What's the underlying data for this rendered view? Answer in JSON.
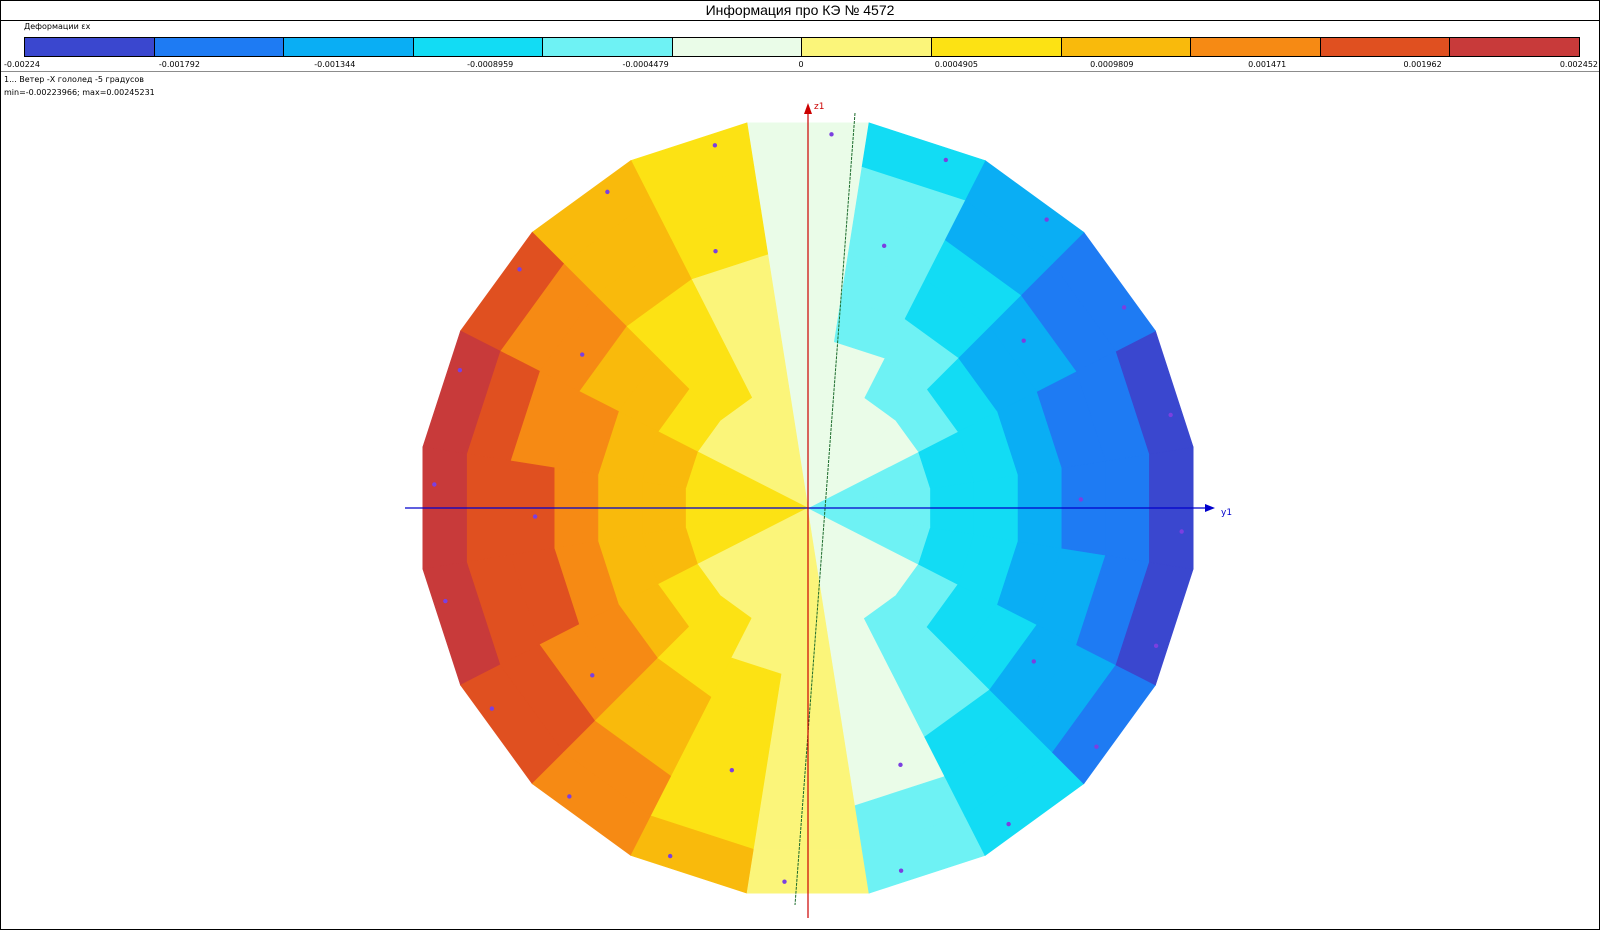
{
  "window": {
    "title": "Информация про КЭ № 4572"
  },
  "legend": {
    "caption": "Деформации εx",
    "segment_colors": [
      "#3a47cf",
      "#1e7bf3",
      "#0aaef4",
      "#12dcf4",
      "#6ef2f4",
      "#eafce8",
      "#fbf57a",
      "#fce214",
      "#f9ba0c",
      "#f68a14",
      "#e05020",
      "#c83a3a"
    ],
    "ticks": [
      "-0.00224",
      "-0.001792",
      "-0.001344",
      "-0.0008959",
      "-0.0004479",
      "0",
      "0.0004905",
      "0.0009809",
      "0.001471",
      "0.001962",
      "0.002452"
    ]
  },
  "info": {
    "load_case": "1... Ветер -X гололед -5 градусов",
    "range": "min=-0.00223966; max=0.00245231"
  },
  "plot": {
    "axis_z_label": "z1",
    "axis_y_label": "y1",
    "axis_z_color": "#cc0000",
    "axis_y_color": "#0000cc",
    "node_color": "#7b3fe0",
    "sectors": 20,
    "rings": 6,
    "strain_min": -0.00223966,
    "strain_max": 0.00245231
  }
}
